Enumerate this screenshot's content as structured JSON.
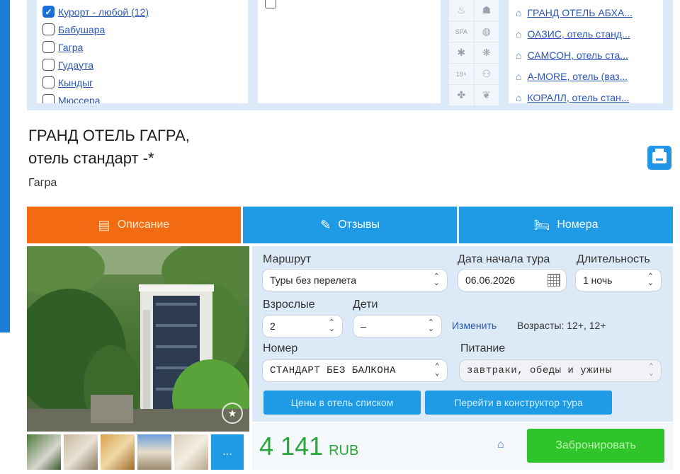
{
  "filters": {
    "resorts": [
      {
        "label": "Курорт - любой (12)",
        "checked": true
      },
      {
        "label": "Бабушара",
        "checked": false
      },
      {
        "label": "Гагра",
        "checked": false
      },
      {
        "label": "Гудаута",
        "checked": false
      },
      {
        "label": "Кындыг",
        "checked": false
      },
      {
        "label": "Мюссера",
        "checked": false
      }
    ],
    "amenity_icons": [
      "sauna-icon",
      "bathrobe-icon",
      "spa-icon",
      "ball-icon",
      "medical-icon",
      "pet-icon",
      "adult-18-icon",
      "family-icon",
      "dog-icon",
      "handshake-icon"
    ],
    "amenity_text": {
      "spa": "SPA",
      "adult": "18+"
    },
    "hotels": [
      "ГРАНД ОТЕЛЬ АБХА...",
      "ОАЗИС, отель станд...",
      "САМСОН, отель ста...",
      "A-MORE, отель (ваз...",
      "КОРАЛЛ, отель стан..."
    ]
  },
  "hotel": {
    "name_line1": "ГРАНД ОТЕЛЬ ГАГРА,",
    "name_line2": "отель стандарт -*",
    "city": "Гагра"
  },
  "tabs": [
    {
      "label": "Описание",
      "icon": "document-icon",
      "active": true
    },
    {
      "label": "Отзывы",
      "icon": "pencil-icon",
      "active": false
    },
    {
      "label": "Номера",
      "icon": "bed-icon",
      "active": false
    }
  ],
  "gallery": {
    "more_label": "..."
  },
  "form": {
    "route_label": "Маршрут",
    "route_value": "Туры без перелета",
    "date_label": "Дата начала тура",
    "date_value": "06.06.2026",
    "duration_label": "Длительность",
    "duration_value": "1 ночь",
    "adults_label": "Взрослые",
    "adults_value": "2",
    "children_label": "Дети",
    "children_value": "–",
    "change_link": "Изменить",
    "ages_text": "Возрасты: 12+, 12+",
    "room_label": "Номер",
    "room_value": "СТАНДАРТ БЕЗ БАЛКОНА",
    "meal_label": "Питание",
    "meal_value": "завтраки, обеды и ужины",
    "btn_prices_list": "Цены в отель списком",
    "btn_constructor": "Перейти в конструктор тура"
  },
  "price": {
    "amount": "4 141",
    "currency": "RUB"
  },
  "book_label": "Забронировать",
  "colors": {
    "accent_orange": "#f26b12",
    "tab_blue": "#1f9be6",
    "price_green": "#27a83a",
    "book_green": "#2fc52a",
    "panel_bg": "#dce9f6"
  }
}
